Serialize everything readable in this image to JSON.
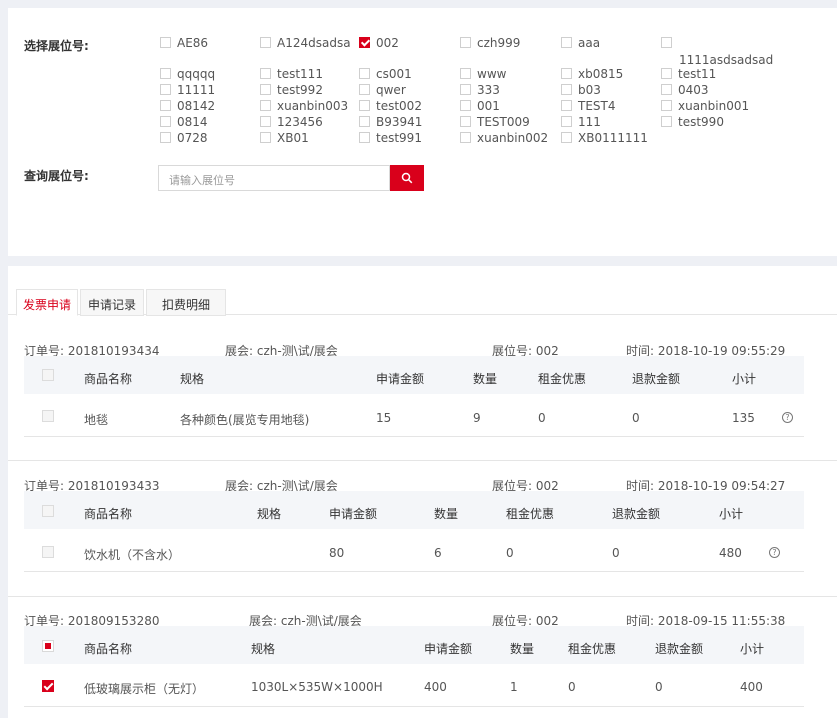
{
  "filter": {
    "select_label": "选择展位号:",
    "query_label": "查询展位号:",
    "search_placeholder": "请输入展位号",
    "booths_row1": [
      {
        "label": "AE86",
        "checked": false
      },
      {
        "label": "A124dsadsa",
        "checked": false
      },
      {
        "label": "002",
        "checked": true
      },
      {
        "label": "czh999",
        "checked": false
      },
      {
        "label": "aaa",
        "checked": false
      },
      {
        "label": "1111asdsadsad",
        "checked": false
      }
    ],
    "booths_grid": [
      [
        "qqqqq",
        "test111",
        "cs001",
        "www",
        "xb0815",
        "test11"
      ],
      [
        "11111",
        "test992",
        "qwer",
        "333",
        "b03",
        "0403"
      ],
      [
        "08142",
        "xuanbin003",
        "test002",
        "001",
        "TEST4",
        "xuanbin001"
      ],
      [
        "0814",
        "123456",
        "B93941",
        "TEST009",
        "111",
        "test990"
      ],
      [
        "0728",
        "XB01",
        "test991",
        "xuanbin002",
        "XB0111111",
        ""
      ]
    ]
  },
  "tabs": [
    "发票申请",
    "申请记录",
    "扣费明细"
  ],
  "orders": [
    {
      "order_no": "订单号: 201810193434",
      "exhibition": "展会: czh-测\\试/展会",
      "booth": "展位号: 002",
      "time": "时间: 2018-10-19 09:55:29",
      "headers": [
        "商品名称",
        "规格",
        "申请金额",
        "数量",
        "租金优惠",
        "退款金额",
        "小计"
      ],
      "items": [
        {
          "name": "地毯",
          "spec": "各种颜色(展览专用地毯)",
          "amount": "15",
          "qty": "9",
          "discount": "0",
          "refund": "0",
          "subtotal": "135"
        }
      ]
    },
    {
      "order_no": "订单号: 201810193433",
      "exhibition": "展会: czh-测\\试/展会",
      "booth": "展位号: 002",
      "time": "时间: 2018-10-19 09:54:27",
      "headers": [
        "商品名称",
        "规格",
        "申请金额",
        "数量",
        "租金优惠",
        "退款金额",
        "小计"
      ],
      "items": [
        {
          "name": "饮水机（不含水）",
          "spec": "",
          "amount": "80",
          "qty": "6",
          "discount": "0",
          "refund": "0",
          "subtotal": "480"
        }
      ]
    },
    {
      "order_no": "订单号: 201809153280",
      "exhibition": "展会: czh-测\\试/展会",
      "booth": "展位号: 002",
      "time": "时间: 2018-09-15 11:55:38",
      "headers": [
        "商品名称",
        "规格",
        "申请金额",
        "数量",
        "租金优惠",
        "退款金额",
        "小计"
      ],
      "items": [
        {
          "name": "低玻璃展示柜（无灯）",
          "spec": "1030L×535W×1000H",
          "amount": "400",
          "qty": "1",
          "discount": "0",
          "refund": "0",
          "subtotal": "400"
        }
      ]
    }
  ],
  "colors": {
    "accent": "#d9001b",
    "header_bg": "#f4f6f9",
    "page_bg": "#eef0f5"
  },
  "icons": {
    "search": "search-icon",
    "help": "help-circle-icon"
  }
}
